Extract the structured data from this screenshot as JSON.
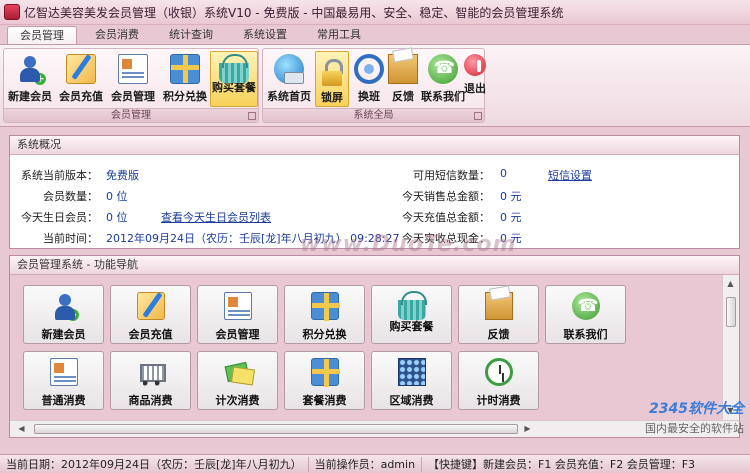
{
  "window": {
    "title": "亿智达美容美发会员管理（收银）系统V10 - 免费版 - 中国最易用、安全、稳定、智能的会员管理系统"
  },
  "tabs": [
    "会员管理",
    "会员消费",
    "统计查询",
    "系统设置",
    "常用工具"
  ],
  "ribbon": {
    "group1": {
      "label": "会员管理",
      "buttons": [
        "新建会员",
        "会员充值",
        "会员管理",
        "积分兑换",
        "购买套餐"
      ]
    },
    "group2": {
      "label": "系统全局",
      "buttons": [
        "系统首页",
        "锁屏",
        "换班",
        "反馈",
        "联系我们",
        "退出"
      ]
    }
  },
  "overview": {
    "title": "系统概况",
    "version_label": "系统当前版本：",
    "version_value": "免费版",
    "member_count_label": "会员数量：",
    "member_count_value": "0 位",
    "birthday_label": "今天生日会员：",
    "birthday_value": "0 位",
    "birthday_link": "查看今天生日会员列表",
    "time_label": "当前时间：",
    "time_value": "2012年09月24日（农历：壬辰[龙]年八月初九）  09:28:27",
    "sms_label": "可用短信数量：",
    "sms_value": "0",
    "sms_link": "短信设置",
    "sales_label": "今天销售总金额：",
    "sales_value": "0 元",
    "recharge_label": "今天充值总金额：",
    "recharge_value": "0 元",
    "cash_label": "今天实收总现金：",
    "cash_value": "0 元",
    "watermark": "www.DuoTe.com"
  },
  "nav": {
    "title": "会员管理系统 - 功能导航",
    "row1": [
      "新建会员",
      "会员充值",
      "会员管理",
      "积分兑换",
      "购买套餐",
      "反馈",
      "联系我们"
    ],
    "row2": [
      "普通消费",
      "商品消费",
      "计次消费",
      "套餐消费",
      "区域消费",
      "计时消费"
    ]
  },
  "brand": {
    "line1": "2345软件大全",
    "line2": "国内最安全的软件站"
  },
  "status": {
    "date": "当前日期：2012年09月24日（农历：壬辰[龙]年八月初九）",
    "operator": "当前操作员：admin",
    "shortcuts": "【快捷键】新建会员：F1  会员充值：F2  会员管理：F3"
  }
}
